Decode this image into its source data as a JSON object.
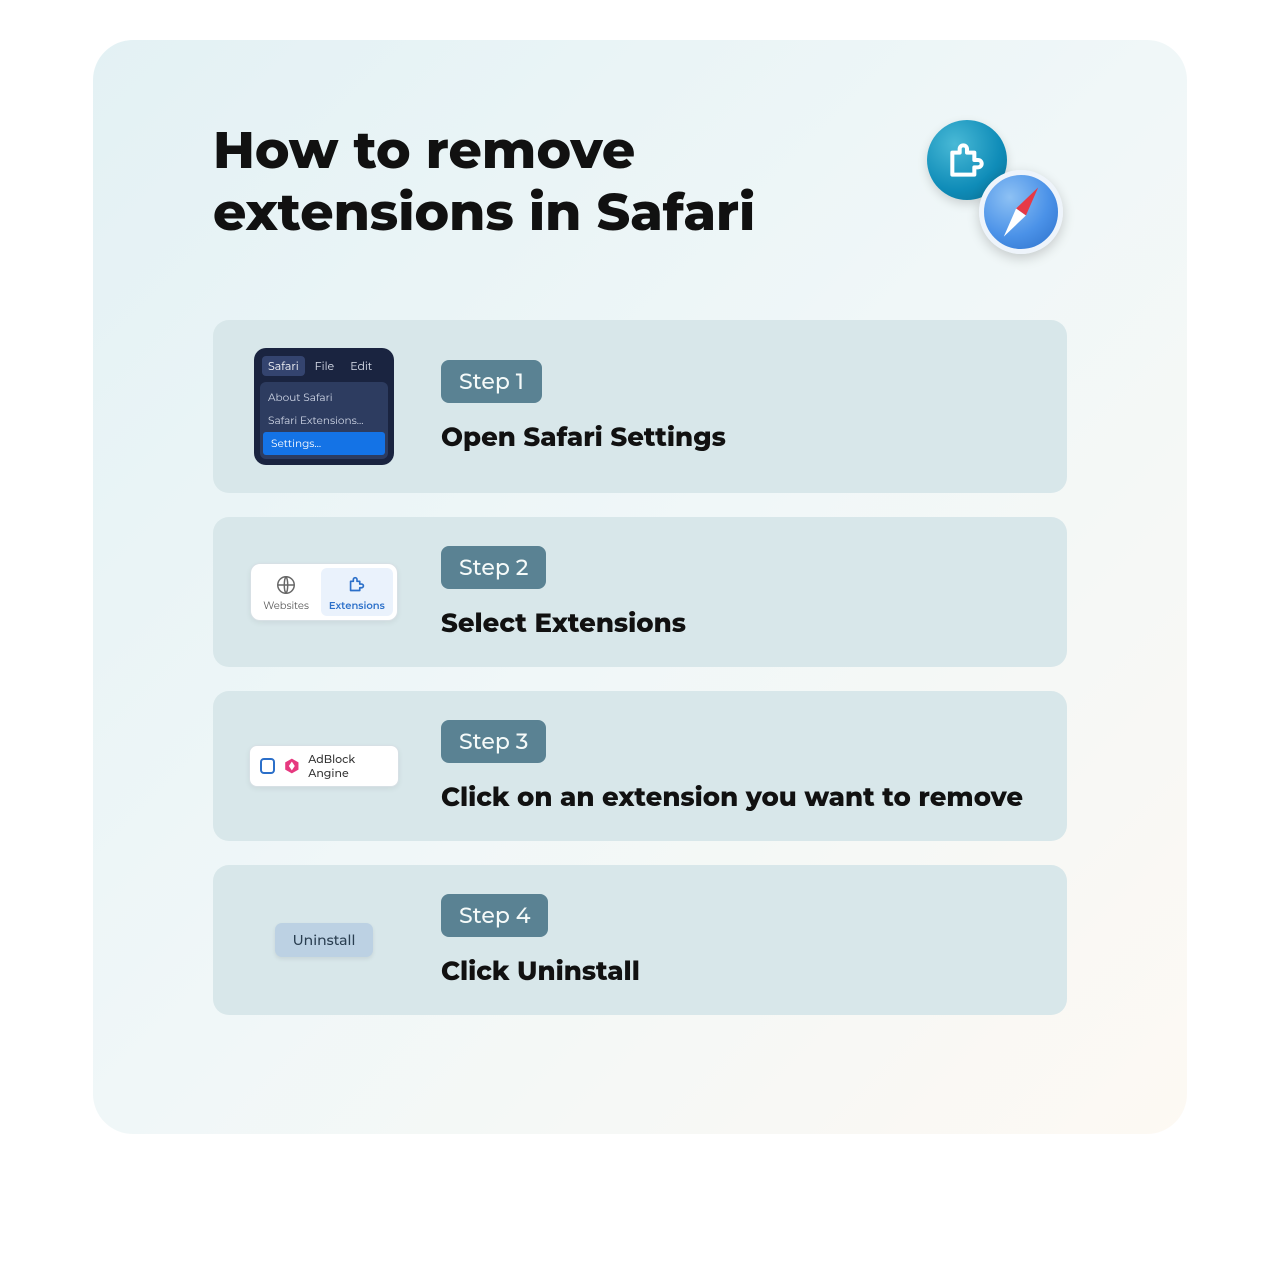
{
  "title": "How to remove extensions in Safari",
  "steps": [
    {
      "badge": "Step 1",
      "title": "Open Safari Settings",
      "menu": {
        "bar": [
          "Safari",
          "File",
          "Edit"
        ],
        "items": [
          "About Safari",
          "Safari Extensions...",
          "Settings..."
        ]
      }
    },
    {
      "badge": "Step 2",
      "title": "Select Extensions",
      "tabs": {
        "websites": "Websites",
        "extensions": "Extensions"
      }
    },
    {
      "badge": "Step 3",
      "title": "Click on an extension you want to remove",
      "extension_name": "AdBlock Angine"
    },
    {
      "badge": "Step 4",
      "title": "Click Uninstall",
      "button_label": "Uninstall"
    }
  ]
}
